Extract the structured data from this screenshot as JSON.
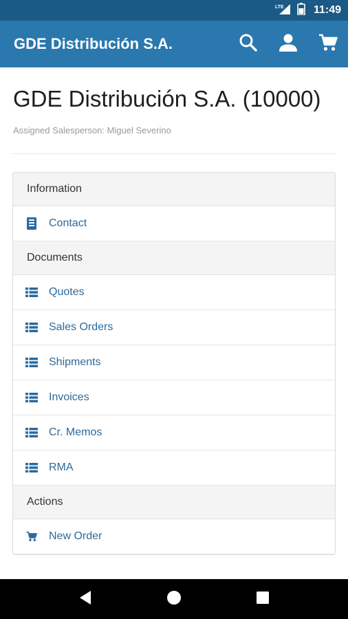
{
  "status_bar": {
    "network": "LTE",
    "time": "11:49"
  },
  "app_bar": {
    "title": "GDE Distribución S.A.",
    "actions": {
      "search_icon": "search-icon",
      "account_icon": "account-icon",
      "cart_icon": "cart-icon"
    }
  },
  "customer": {
    "title": "GDE Distribución S.A. (10000)",
    "salesperson": "Assigned Salesperson: Miguel Severino"
  },
  "sections": [
    {
      "header": "Information",
      "items": [
        {
          "label": "Contact",
          "icon": "address-book-icon"
        }
      ]
    },
    {
      "header": "Documents",
      "items": [
        {
          "label": "Quotes",
          "icon": "list-icon"
        },
        {
          "label": "Sales Orders",
          "icon": "list-icon"
        },
        {
          "label": "Shipments",
          "icon": "list-icon"
        },
        {
          "label": "Invoices",
          "icon": "list-icon"
        },
        {
          "label": "Cr. Memos",
          "icon": "list-icon"
        },
        {
          "label": "RMA",
          "icon": "list-icon"
        }
      ]
    },
    {
      "header": "Actions",
      "items": [
        {
          "label": "New Order",
          "icon": "cart-icon"
        }
      ]
    }
  ],
  "colors": {
    "app_bar": "#2a78ad",
    "status_bar": "#1a5a85",
    "link": "#2a6a9e"
  }
}
